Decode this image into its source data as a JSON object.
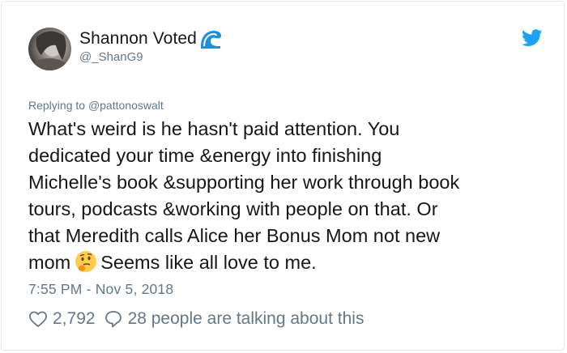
{
  "tweet": {
    "display_name": "Shannon Voted",
    "name_icon": "water-wave-icon",
    "handle": "@_ShanG9",
    "platform_icon": "twitter-bird-icon",
    "reply_prefix": "Replying to",
    "reply_to": "@pattonoswalt",
    "text_lines": [
      "What's weird is he hasn't paid attention. You",
      "dedicated your time &energy into finishing",
      "Michelle's book &supporting her work through book",
      "tours, podcasts &working with people on that. Or",
      "that Meredith calls Alice her Bonus Mom not new"
    ],
    "last_line_before_emoji": "mom",
    "emoji": "thinking-face-icon",
    "last_line_after_emoji": "Seems like all love to me.",
    "timestamp": "7:55 PM - Nov 5, 2018",
    "likes": "2,792",
    "talking": "28 people are talking about this"
  },
  "colors": {
    "text": "#14171a",
    "secondary": "#657786",
    "twitter_blue": "#1da1f2",
    "border": "#e1e8ed"
  }
}
